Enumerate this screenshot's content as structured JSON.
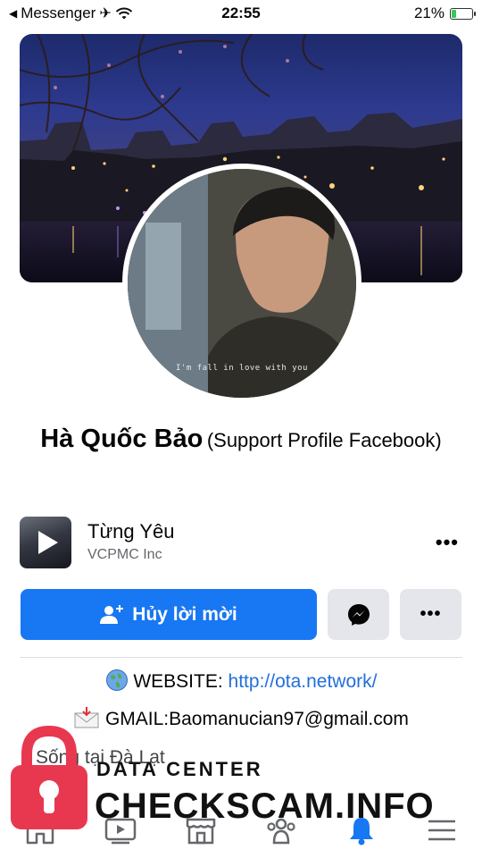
{
  "status_bar": {
    "back_app": "Messenger",
    "time": "22:55",
    "battery": "21%",
    "battery_level": 0.21
  },
  "avatar": {
    "caption": "I'm fall in love with you"
  },
  "profile": {
    "name": "Hà Quốc Bảo",
    "name_suffix": "(Support Profile Facebook)"
  },
  "music": {
    "title": "Từng Yêu",
    "artist": "VCPMC Inc",
    "more": "•••"
  },
  "actions": {
    "primary_label": "Hủy lời mời",
    "more": "•••"
  },
  "intro": {
    "website_label": "WEBSITE:",
    "website_url": "http://ota.network/",
    "gmail": "GMAIL:Baomanucian97@gmail.com",
    "lives_in": "Sống tại Đà Lạt"
  },
  "watermark": {
    "line1": "DATA CENTER",
    "line2": "CHECKSCAM.INFO"
  },
  "colors": {
    "primary": "#1877f2",
    "link": "#216fdb",
    "secondary_button": "#e4e6eb",
    "watermark_lock": "#e8384f"
  },
  "icons": {
    "airplane": "airplane-icon",
    "wifi": "wifi-icon",
    "messenger": "messenger-icon",
    "globe": "globe-icon",
    "envelope": "envelope-icon",
    "home": "home-icon",
    "watch": "watch-icon",
    "marketplace": "marketplace-icon",
    "groups": "groups-icon",
    "notifications": "bell-icon",
    "menu": "menu-icon"
  }
}
